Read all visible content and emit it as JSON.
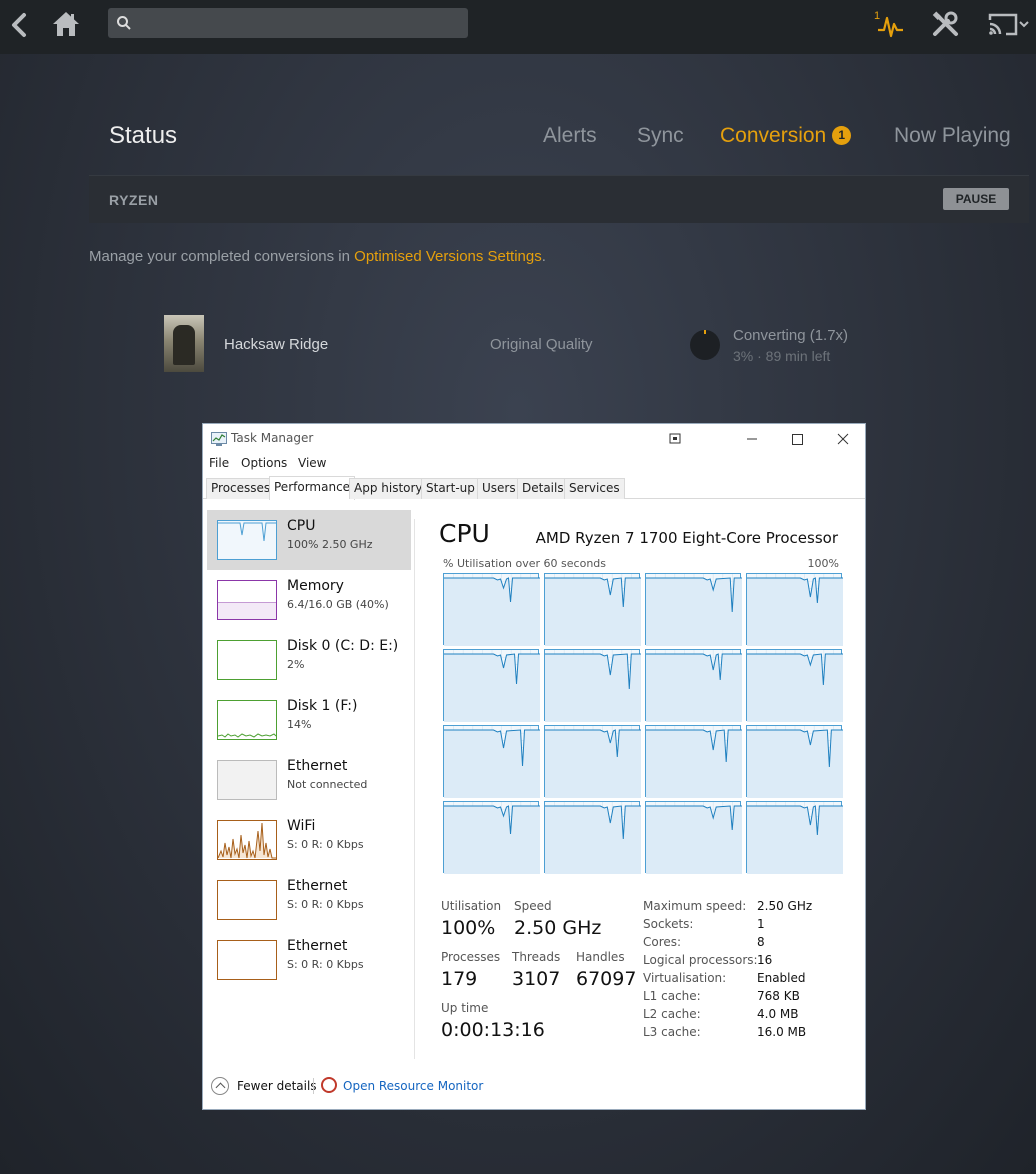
{
  "topbar": {
    "search_placeholder": "",
    "activity_count": "1",
    "accent": "#e5a00d"
  },
  "status": {
    "title": "Status",
    "tabs": [
      {
        "label": "Alerts"
      },
      {
        "label": "Sync"
      },
      {
        "label": "Conversion",
        "badge": "1"
      },
      {
        "label": "Now Playing"
      }
    ],
    "active_tab": "Conversion",
    "server": {
      "name": "RYZEN",
      "pause_label": "PAUSE"
    },
    "manage_prefix": "Manage your completed conversions in ",
    "manage_link": "Optimised Versions Settings",
    "manage_suffix": ".",
    "conversion": {
      "title": "Hacksaw Ridge",
      "quality": "Original Quality",
      "status": "Converting (1.7x)",
      "detail": "3% · 89 min left",
      "progress_fraction": 0.03
    }
  },
  "task_manager": {
    "title": "Task Manager",
    "menu": [
      "File",
      "Options",
      "View"
    ],
    "tabs": [
      "Processes",
      "Performance",
      "App history",
      "Start-up",
      "Users",
      "Details",
      "Services"
    ],
    "active_tab": "Performance",
    "resources": [
      {
        "name": "CPU",
        "detail": "100%  2.50 GHz",
        "color": "#4d9fd3",
        "selected": true
      },
      {
        "name": "Memory",
        "detail": "6.4/16.0 GB (40%)",
        "color": "#8b36a8"
      },
      {
        "name": "Disk 0 (C: D: E:)",
        "detail": "2%",
        "color": "#4da032"
      },
      {
        "name": "Disk 1 (F:)",
        "detail": "14%",
        "color": "#4da032"
      },
      {
        "name": "Ethernet",
        "detail": "Not connected",
        "color": "#bbbbbb"
      },
      {
        "name": "WiFi",
        "detail": "S: 0  R: 0 Kbps",
        "color": "#a75f1a"
      },
      {
        "name": "Ethernet",
        "detail": "S: 0  R: 0 Kbps",
        "color": "#a75f1a"
      },
      {
        "name": "Ethernet",
        "detail": "S: 0  R: 0 Kbps",
        "color": "#a75f1a"
      }
    ],
    "cpu": {
      "heading": "CPU",
      "model": "AMD Ryzen 7 1700 Eight-Core Processor",
      "graph_label": "% Utilisation over 60 seconds",
      "graph_max": "100%",
      "core_count": 16,
      "stats": {
        "utilisation_label": "Utilisation",
        "utilisation": "100%",
        "speed_label": "Speed",
        "speed": "2.50 GHz",
        "processes_label": "Processes",
        "processes": "179",
        "threads_label": "Threads",
        "threads": "3107",
        "handles_label": "Handles",
        "handles": "67097",
        "uptime_label": "Up time",
        "uptime": "0:00:13:16"
      },
      "details": [
        {
          "key": "Maximum speed:",
          "value": "2.50 GHz"
        },
        {
          "key": "Sockets:",
          "value": "1"
        },
        {
          "key": "Cores:",
          "value": "8"
        },
        {
          "key": "Logical processors:",
          "value": "16"
        },
        {
          "key": "Virtualisation:",
          "value": "Enabled"
        },
        {
          "key": "L1 cache:",
          "value": "768 KB"
        },
        {
          "key": "L2 cache:",
          "value": "4.0 MB"
        },
        {
          "key": "L3 cache:",
          "value": "16.0 MB"
        }
      ]
    },
    "footer": {
      "fewer_details": "Fewer details",
      "resource_monitor": "Open Resource Monitor"
    }
  }
}
